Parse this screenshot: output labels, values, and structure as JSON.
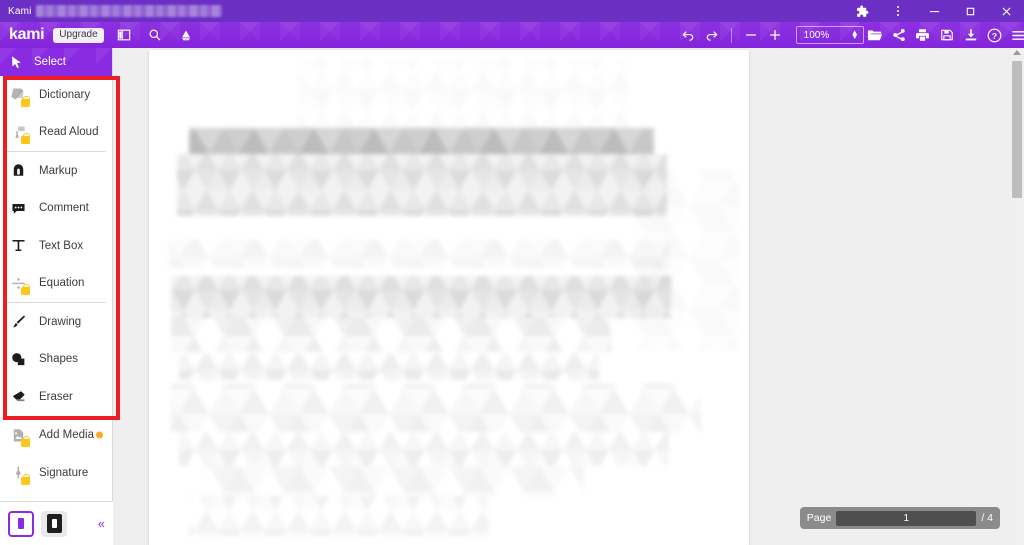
{
  "window": {
    "app_title": "Kami",
    "title_redacted": true,
    "controls": {
      "extensions": "extensions-puzzle-icon",
      "menu": "browser-menu-icon",
      "minimize": "minimize-icon",
      "maximize": "maximize-icon",
      "close": "close-icon"
    }
  },
  "toolbar": {
    "logo": "kami",
    "upgrade_label": "Upgrade",
    "left_icons": [
      {
        "name": "panel-toggle-icon",
        "label": "Toggle Split View"
      },
      {
        "name": "search-icon",
        "label": "Search"
      },
      {
        "name": "google-drive-icon",
        "label": "Google Drive"
      }
    ],
    "undo_label": "Undo",
    "redo_label": "Redo",
    "zoom_out_label": "Zoom Out",
    "zoom_in_label": "Zoom In",
    "zoom_value": "100%",
    "right_icons": [
      {
        "name": "open-folder-icon",
        "label": "Open"
      },
      {
        "name": "share-icon",
        "label": "Share"
      },
      {
        "name": "print-icon",
        "label": "Print"
      },
      {
        "name": "save-icon",
        "label": "Save"
      },
      {
        "name": "download-icon",
        "label": "Download"
      },
      {
        "name": "help-icon",
        "label": "Help"
      },
      {
        "name": "hamburger-menu-icon",
        "label": "Menu"
      }
    ],
    "avatar_color": "#36bf4e"
  },
  "sidebar": {
    "select": {
      "label": "Select",
      "icon": "cursor-arrow-icon",
      "active": true
    },
    "groups": [
      {
        "items": [
          {
            "label": "Dictionary",
            "icon": "book-icon",
            "locked": true
          },
          {
            "label": "Read Aloud",
            "icon": "microphone-icon",
            "locked": true
          }
        ]
      },
      {
        "items": [
          {
            "label": "Markup",
            "icon": "highlighter-icon",
            "locked": false
          },
          {
            "label": "Comment",
            "icon": "comment-bubble-icon",
            "locked": false
          },
          {
            "label": "Text Box",
            "icon": "text-t-icon",
            "locked": false
          },
          {
            "label": "Equation",
            "icon": "division-sign-icon",
            "locked": true
          }
        ]
      },
      {
        "items": [
          {
            "label": "Drawing",
            "icon": "paintbrush-icon",
            "locked": false
          },
          {
            "label": "Shapes",
            "icon": "shapes-icon",
            "locked": false
          },
          {
            "label": "Eraser",
            "icon": "eraser-icon",
            "locked": false
          }
        ]
      },
      {
        "items": [
          {
            "label": "Add Media",
            "icon": "image-file-icon",
            "locked": true,
            "badge": true
          },
          {
            "label": "Signature",
            "icon": "signature-icon",
            "locked": true
          }
        ]
      }
    ],
    "bottom": {
      "light_view_label": "Light View",
      "dark_view_label": "Dark View",
      "collapse_label": "«"
    },
    "annotation": {
      "highlight_color": "#ec1c24"
    }
  },
  "viewer": {
    "page_label": "Page",
    "current_page": "1",
    "page_total": "/ 4",
    "document_redacted": true
  }
}
